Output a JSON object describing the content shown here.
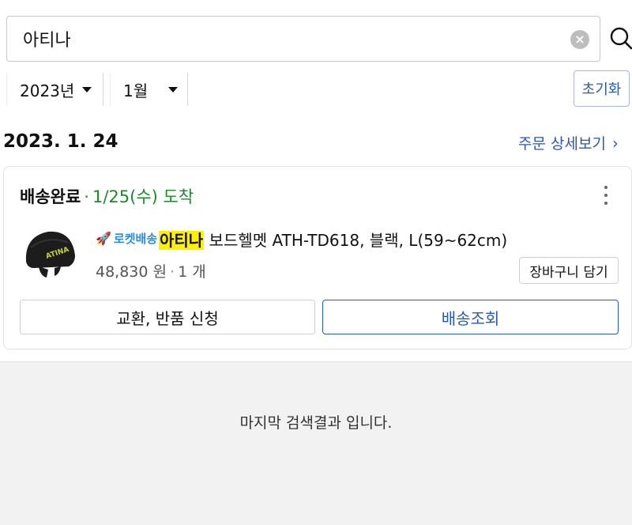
{
  "search": {
    "value": "아티나",
    "placeholder": ""
  },
  "filters": {
    "year": "2023년",
    "month": "1월",
    "reset_label": "초기화"
  },
  "order": {
    "date": "2023. 1. 24",
    "detail_link": "주문 상세보기",
    "status": "배송완료",
    "status_dot": "·",
    "arrival": "1/25(수) 도착",
    "item": {
      "badge": "로켓배송",
      "name_highlight": "아티나",
      "name_rest": " 보드헬멧 ATH-TD618, 블랙, L(59~62cm)",
      "price": "48,830 원",
      "quantity_sep": "·",
      "quantity": "1 개",
      "helmet_logo_text": "ATINA",
      "cart_label": "장바구니 담기"
    },
    "actions": {
      "exchange_label": "교환, 반품 신청",
      "track_label": "배송조회"
    }
  },
  "footer": {
    "end_message": "마지막 검색결과 입니다."
  },
  "colors": {
    "accent": "#2a5aa8",
    "status_green": "#1a8a2a",
    "highlight": "#ffef00",
    "rocket_blue": "#2a8fd6"
  }
}
